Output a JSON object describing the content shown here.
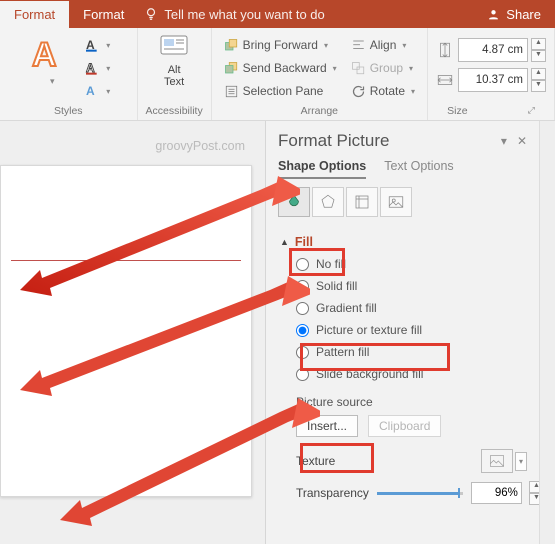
{
  "tabs": {
    "format1": "Format",
    "format2": "Format",
    "tell_me": "Tell me what you want to do",
    "share": "Share"
  },
  "ribbon": {
    "styles_label": "Styles",
    "accessibility_label": "Accessibility",
    "alt_text": "Alt\nText",
    "arrange_label": "Arrange",
    "bring_forward": "Bring Forward",
    "send_backward": "Send Backward",
    "selection_pane": "Selection Pane",
    "align": "Align",
    "group": "Group",
    "rotate": "Rotate",
    "size_label": "Size",
    "height": "4.87 cm",
    "width": "10.37 cm"
  },
  "watermark": "groovyPost.com",
  "pane": {
    "title": "Format Picture",
    "shape_options": "Shape Options",
    "text_options": "Text Options",
    "section_fill": "Fill",
    "fill_options": {
      "no_fill": "No fill",
      "solid": "Solid fill",
      "gradient": "Gradient fill",
      "picture": "Picture or texture fill",
      "pattern": "Pattern fill",
      "slide_bg": "Slide background fill"
    },
    "picture_source": "Picture source",
    "insert": "Insert...",
    "clipboard": "Clipboard",
    "texture": "Texture",
    "transparency": "Transparency",
    "transparency_value": "96%"
  }
}
